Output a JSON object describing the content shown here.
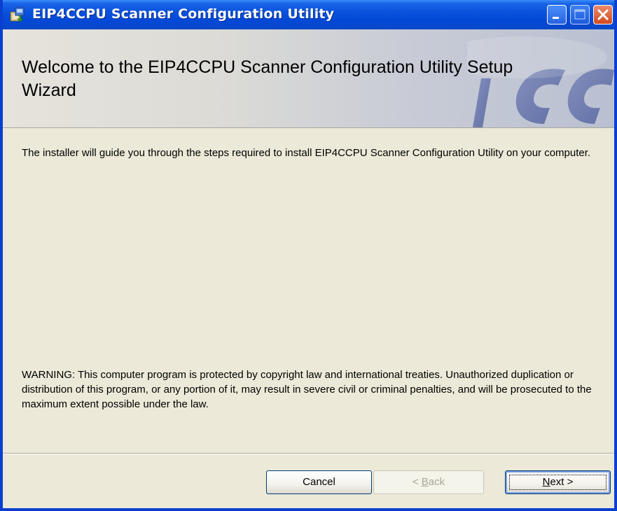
{
  "window": {
    "title": "EIP4CCPU Scanner Configuration Utility",
    "icon": "installer-package-icon",
    "controls": [
      "minimize-icon",
      "maximize-icon",
      "close-icon"
    ]
  },
  "banner": {
    "title": "Welcome to the EIP4CCPU Scanner Configuration Utility Setup Wizard",
    "logo": "ICC"
  },
  "content": {
    "intro": "The installer will guide you through the steps required to install EIP4CCPU Scanner Configuration Utility on your computer.",
    "warning": "WARNING: This computer program is protected by copyright law and international treaties. Unauthorized duplication or distribution of this program, or any portion of it, may result in severe civil or criminal penalties, and will be prosecuted to the maximum extent possible under the law."
  },
  "buttons": {
    "cancel": "Cancel",
    "back_prefix": "< ",
    "back_accel": "B",
    "back_rest": "ack",
    "next_accel": "N",
    "next_rest": "ext >"
  },
  "colors": {
    "titlebar": "#0a52dc",
    "dialog_background": "#ece9d8",
    "close_button": "#d24a1e",
    "logo": "#5a6aa3"
  }
}
